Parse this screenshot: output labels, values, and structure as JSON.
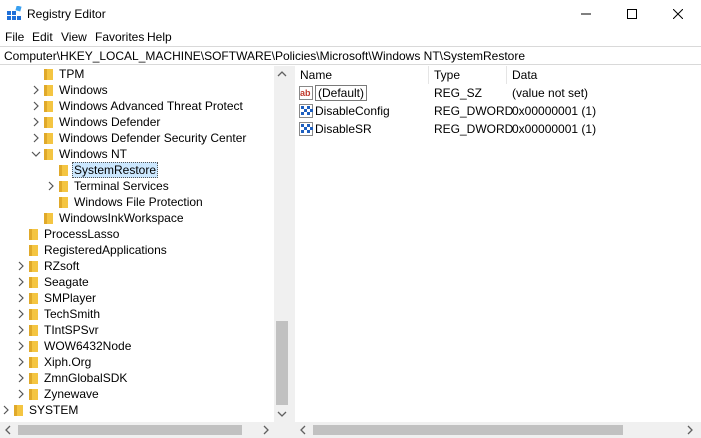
{
  "window": {
    "title": "Registry Editor"
  },
  "menu": [
    "File",
    "Edit",
    "View",
    "Favorites",
    "Help"
  ],
  "address": "Computer\\HKEY_LOCAL_MACHINE\\SOFTWARE\\Policies\\Microsoft\\Windows NT\\SystemRestore",
  "tree": [
    {
      "label": "TPM",
      "expander": "none"
    },
    {
      "label": "Windows",
      "expander": "collapsed"
    },
    {
      "label": "Windows Advanced Threat Protect",
      "expander": "collapsed"
    },
    {
      "label": "Windows Defender",
      "expander": "collapsed"
    },
    {
      "label": "Windows Defender Security Center",
      "expander": "collapsed"
    },
    {
      "label": "Windows NT",
      "expander": "expanded"
    },
    {
      "label": "SystemRestore",
      "expander": "none",
      "selected": true
    },
    {
      "label": "Terminal Services",
      "expander": "collapsed"
    },
    {
      "label": "Windows File Protection",
      "expander": "none"
    },
    {
      "label": "WindowsInkWorkspace",
      "expander": "none"
    },
    {
      "label": "ProcessLasso",
      "expander": "none"
    },
    {
      "label": "RegisteredApplications",
      "expander": "none"
    },
    {
      "label": "RZsoft",
      "expander": "collapsed"
    },
    {
      "label": "Seagate",
      "expander": "collapsed"
    },
    {
      "label": "SMPlayer",
      "expander": "collapsed"
    },
    {
      "label": "TechSmith",
      "expander": "collapsed"
    },
    {
      "label": "TIntSPSvr",
      "expander": "collapsed"
    },
    {
      "label": "WOW6432Node",
      "expander": "collapsed"
    },
    {
      "label": "Xiph.Org",
      "expander": "collapsed"
    },
    {
      "label": "ZmnGlobalSDK",
      "expander": "collapsed"
    },
    {
      "label": "Zynewave",
      "expander": "collapsed"
    },
    {
      "label": "SYSTEM",
      "expander": "collapsed"
    }
  ],
  "list": {
    "columns": [
      "Name",
      "Type",
      "Data"
    ],
    "rows": [
      {
        "name": "(Default)",
        "type": "REG_SZ",
        "data": "(value not set)",
        "icon": "string-value-icon"
      },
      {
        "name": "DisableConfig",
        "type": "REG_DWORD",
        "data": "0x00000001 (1)",
        "icon": "binary-value-icon"
      },
      {
        "name": "DisableSR",
        "type": "REG_DWORD",
        "data": "0x00000001 (1)",
        "icon": "binary-value-icon"
      }
    ]
  },
  "colors": {
    "selection": "#cce8ff",
    "folder": "#f4c542",
    "scroll_thumb": "#c1c1c1"
  }
}
